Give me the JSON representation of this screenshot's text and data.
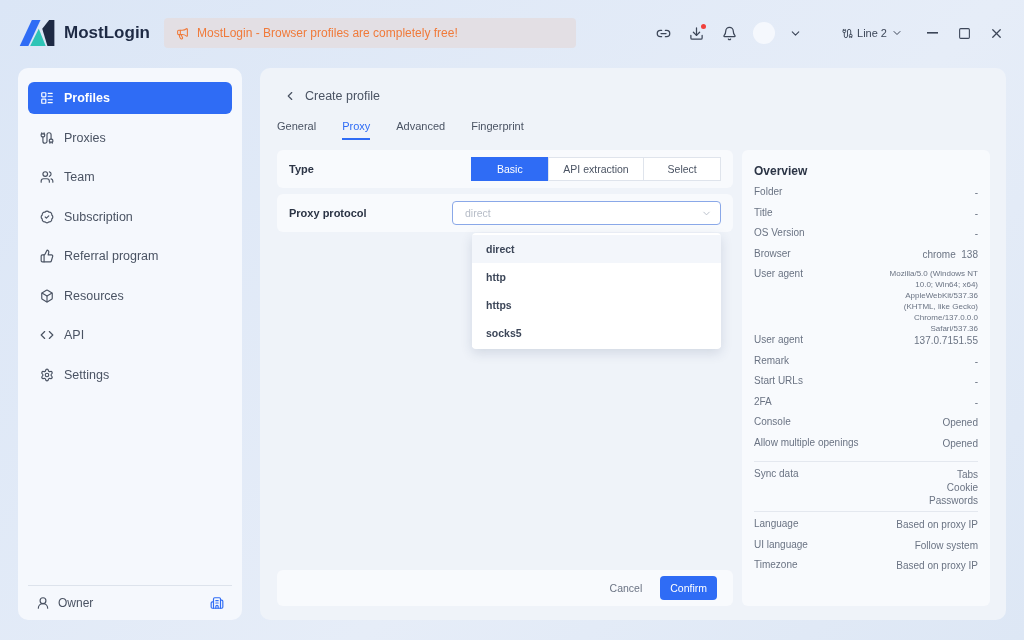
{
  "app": {
    "name": "MostLogin",
    "announcement": "MostLogin - Browser profiles are completely free!",
    "line": "Line 2",
    "download_badge": true
  },
  "sidebar": {
    "items": [
      {
        "label": "Profiles",
        "selected": true
      },
      {
        "label": "Proxies",
        "selected": false
      },
      {
        "label": "Team",
        "selected": false
      },
      {
        "label": "Subscription",
        "selected": false
      },
      {
        "label": "Referral program",
        "selected": false
      },
      {
        "label": "Resources",
        "selected": false
      },
      {
        "label": "API",
        "selected": false
      },
      {
        "label": "Settings",
        "selected": false
      }
    ],
    "footer": {
      "label": "Owner"
    }
  },
  "page": {
    "title": "Create profile"
  },
  "tabs": [
    {
      "label": "General",
      "selected": false
    },
    {
      "label": "Proxy",
      "selected": true
    },
    {
      "label": "Advanced",
      "selected": false
    },
    {
      "label": "Fingerprint",
      "selected": false
    }
  ],
  "form": {
    "type": {
      "label": "Type",
      "options": [
        {
          "label": "Basic",
          "selected": true
        },
        {
          "label": "API extraction",
          "selected": false
        },
        {
          "label": "Select",
          "selected": false
        }
      ]
    },
    "protocol": {
      "label": "Proxy protocol",
      "placeholder": "direct",
      "expanded": true,
      "options": [
        {
          "label": "direct",
          "selected": true
        },
        {
          "label": "http",
          "selected": false
        },
        {
          "label": "https",
          "selected": false
        },
        {
          "label": "socks5",
          "selected": false
        }
      ]
    }
  },
  "buttons": {
    "cancel": "Cancel",
    "confirm": "Confirm"
  },
  "overview": {
    "title": "Overview",
    "sections": [
      [
        {
          "label": "Folder",
          "values": [
            "-"
          ]
        },
        {
          "label": "Title",
          "values": [
            "-"
          ]
        },
        {
          "label": "OS Version",
          "values": [
            "-"
          ]
        },
        {
          "label": "Browser",
          "values": [
            "chrome  138"
          ]
        },
        {
          "label": "User agent",
          "values": [
            "Mozilla/5.0 (Windows NT",
            "10.0; Win64; x64)",
            "AppleWebKit/537.36",
            "(KHTML, like Gecko)",
            "Chrome/137.0.0.0",
            "Safari/537.36"
          ]
        },
        {
          "label": "User agent",
          "values": [
            "137.0.7151.55"
          ]
        },
        {
          "label": "Remark",
          "values": [
            "-"
          ]
        },
        {
          "label": "Start URLs",
          "values": [
            "-"
          ]
        },
        {
          "label": "2FA",
          "values": [
            "-"
          ]
        },
        {
          "label": "Console",
          "values": [
            "Opened"
          ]
        },
        {
          "label": "Allow multiple openings",
          "values": [
            "Opened"
          ]
        }
      ],
      [
        {
          "label": "Sync data",
          "values": [
            "Tabs",
            "Cookie",
            "Passwords"
          ]
        }
      ],
      [
        {
          "label": "Language",
          "values": [
            "Based on proxy IP"
          ]
        },
        {
          "label": "UI language",
          "values": [
            "Follow system"
          ]
        },
        {
          "label": "Timezone",
          "values": [
            "Based on proxy IP"
          ]
        }
      ]
    ]
  }
}
